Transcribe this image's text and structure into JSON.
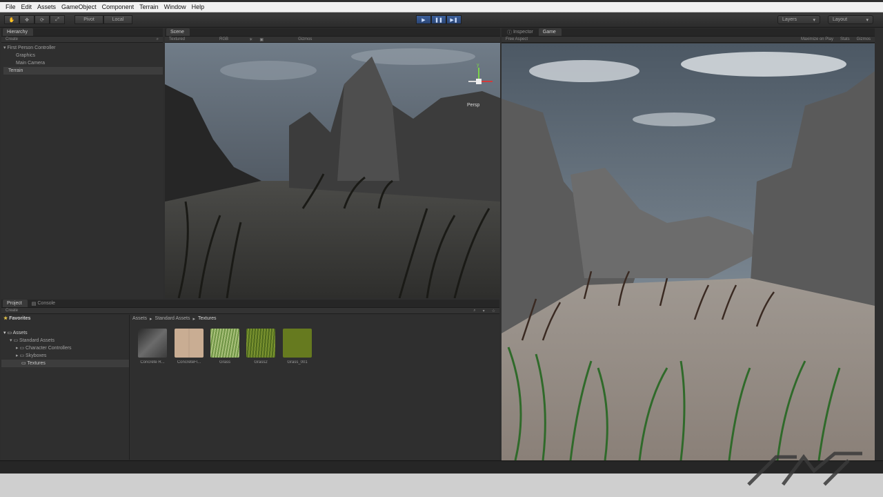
{
  "menu": [
    "File",
    "Edit",
    "Assets",
    "GameObject",
    "Component",
    "Terrain",
    "Window",
    "Help"
  ],
  "toolbar": {
    "pivot_label": "Pivot",
    "local_label": "Local",
    "layers_label": "Layers",
    "layout_label": "Layout"
  },
  "hierarchy": {
    "tab_label": "Hierarchy",
    "create_label": "Create",
    "items": [
      {
        "label": "First Person Controller",
        "indent": 0,
        "expanded": true
      },
      {
        "label": "Graphics",
        "indent": 1
      },
      {
        "label": "Main Camera",
        "indent": 1
      },
      {
        "label": "Terrain",
        "indent": 0
      }
    ]
  },
  "scene": {
    "tab_label": "Scene",
    "render_mode": "Textured",
    "color_mode": "RGB",
    "gizmos_label": "Gizmos",
    "persp_label": "Persp",
    "axis_y": "y"
  },
  "inspector": {
    "tab_label": "Inspector"
  },
  "game": {
    "tab_label": "Game",
    "aspect_label": "Free Aspect",
    "maximize_label": "Maximize on Play",
    "stats_label": "Stats",
    "gizmos_label": "Gizmos"
  },
  "project": {
    "tab_label": "Project",
    "console_tab_label": "Console",
    "create_label": "Create",
    "favorites_label": "Favorites",
    "assets_label": "Assets",
    "tree": [
      {
        "label": "Standard Assets",
        "indent": 1
      },
      {
        "label": "Character Controllers",
        "indent": 2
      },
      {
        "label": "Skyboxes",
        "indent": 2
      },
      {
        "label": "Textures",
        "indent": 2,
        "selected": true
      }
    ],
    "breadcrumb": [
      "Assets",
      "Standard Assets",
      "Textures"
    ],
    "assets": [
      {
        "label": "Concrete R...",
        "color": "#4a4a4a"
      },
      {
        "label": "ConcreteFl...",
        "color": "#c9ad93"
      },
      {
        "label": "Grass",
        "color": "#7fa050"
      },
      {
        "label": "Grass2",
        "color": "#5f7a2a"
      },
      {
        "label": "Grass_001",
        "color": "#667a1f"
      }
    ]
  }
}
